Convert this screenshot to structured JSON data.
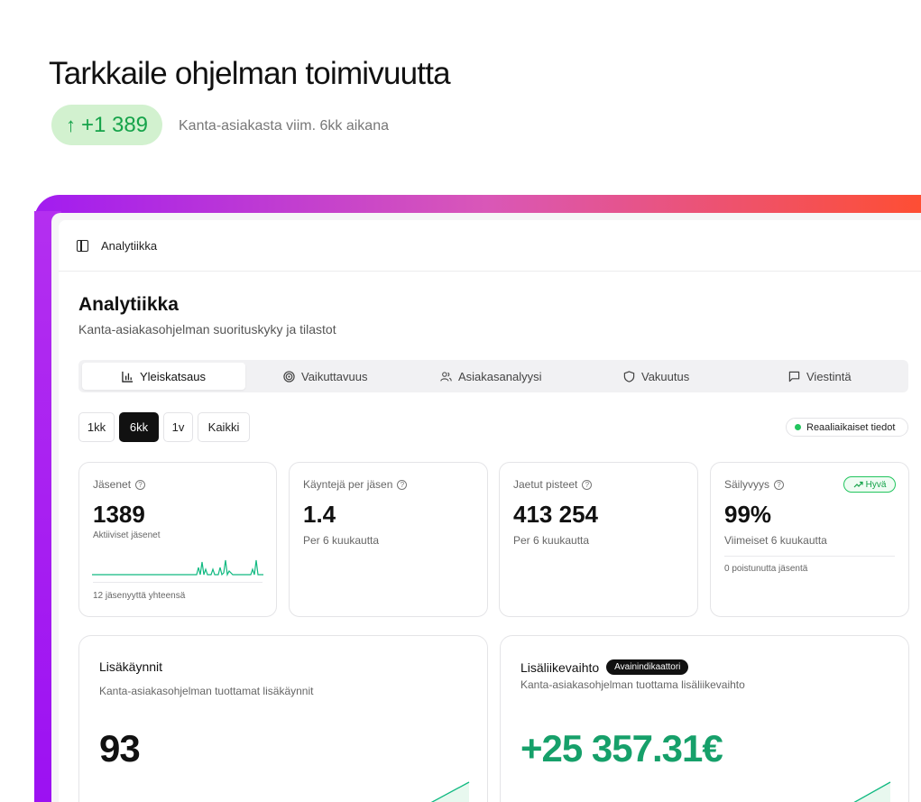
{
  "hero": {
    "title": "Tarkkaile ohjelman toimivuutta",
    "pill_arrow": "↑",
    "pill_value": "+1 389",
    "caption": "Kanta-asiakasta viim. 6kk aikana"
  },
  "app": {
    "breadcrumb": "Analytiikka",
    "title": "Analytiikka",
    "subtitle": "Kanta-asiakasohjelman suorituskyky ja tilastot"
  },
  "tabs": [
    {
      "label": "Yleiskatsaus",
      "icon": "bar-chart-icon",
      "active": true
    },
    {
      "label": "Vaikuttavuus",
      "icon": "target-icon",
      "active": false
    },
    {
      "label": "Asiakasanalyysi",
      "icon": "users-icon",
      "active": false
    },
    {
      "label": "Vakuutus",
      "icon": "shield-icon",
      "active": false
    },
    {
      "label": "Viestintä",
      "icon": "message-icon",
      "active": false
    }
  ],
  "periods": [
    {
      "label": "1kk",
      "active": false
    },
    {
      "label": "6kk",
      "active": true
    },
    {
      "label": "1v",
      "active": false
    },
    {
      "label": "Kaikki",
      "active": false
    }
  ],
  "live_label": "Reaaliaikaiset tiedot",
  "cards": {
    "members": {
      "label": "Jäsenet",
      "value": "1389",
      "sub": "Aktiiviset jäsenet",
      "foot": "12 jäsenyyttä yhteensä"
    },
    "visits_per_member": {
      "label": "Käyntejä per jäsen",
      "value": "1.4",
      "sub": "Per 6 kuukautta"
    },
    "points": {
      "label": "Jaetut pisteet",
      "value": "413 254",
      "sub": "Per 6 kuukautta"
    },
    "retention": {
      "label": "Säilyvyys",
      "badge": "Hyvä",
      "value": "99%",
      "sub": "Viimeiset 6 kuukautta",
      "foot": "0 poistunutta jäsentä"
    }
  },
  "extra_visits": {
    "title": "Lisäkäynnit",
    "subtitle": "Kanta-asiakasohjelman tuottamat lisäkäynnit",
    "value": "93"
  },
  "extra_revenue": {
    "title": "Lisäliikevaihto",
    "badge": "Avainindikaattori",
    "subtitle": "Kanta-asiakasohjelman tuottama lisäliikevaihto",
    "value": "+25 357.31€"
  },
  "colors": {
    "accent_green": "#16a34a",
    "value_green": "#16a06a",
    "gradient_start": "#a21cf0",
    "gradient_end": "#ff4e2f",
    "sparkline": "#10b981"
  }
}
